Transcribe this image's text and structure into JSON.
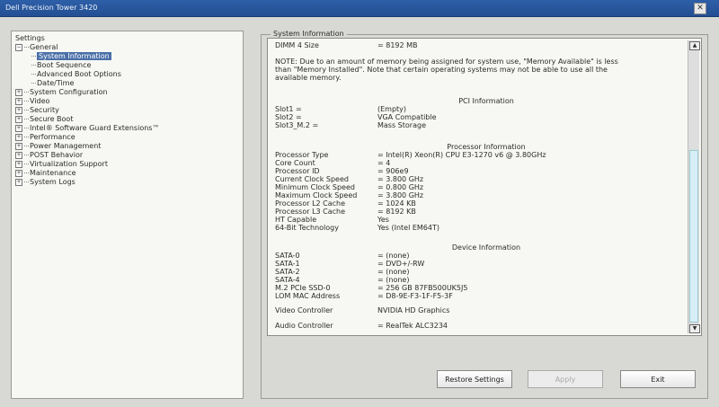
{
  "window": {
    "title": "Dell Precision Tower 3420",
    "close_glyph": "✕"
  },
  "settings_tree": {
    "root": "Settings",
    "general": {
      "label": "General",
      "expander": "−"
    },
    "general_children": [
      "System Information",
      "Boot Sequence",
      "Advanced Boot Options",
      "Date/Time"
    ],
    "sections": [
      "System Configuration",
      "Video",
      "Security",
      "Secure Boot",
      "Intel® Software Guard Extensions™",
      "Performance",
      "Power Management",
      "POST Behavior",
      "Virtualization Support",
      "Maintenance",
      "System Logs"
    ],
    "expander_plus": "+"
  },
  "system_info": {
    "group_title": "System Information",
    "dimm4": {
      "label": "DIMM 4 Size",
      "value": "= 8192 MB"
    },
    "note": "NOTE: Due to an amount of memory being assigned for system use, \"Memory Available\" is less than \"Memory Installed\". Note that certain operating systems may not be able to use all the available memory.",
    "pci_title": "PCI Information",
    "pci": [
      {
        "label": "Slot1 =",
        "value": "(Empty)"
      },
      {
        "label": "Slot2 =",
        "value": "VGA Compatible"
      },
      {
        "label": "Slot3_M.2 =",
        "value": "Mass Storage"
      }
    ],
    "processor_title": "Processor Information",
    "processor": [
      {
        "label": "Processor Type",
        "value": "= Intel(R) Xeon(R) CPU E3-1270 v6 @ 3.80GHz"
      },
      {
        "label": "Core Count",
        "value": "= 4"
      },
      {
        "label": "Processor ID",
        "value": "= 906e9"
      },
      {
        "label": "Current Clock Speed",
        "value": "= 3.800 GHz"
      },
      {
        "label": "Minimum Clock Speed",
        "value": "= 0.800 GHz"
      },
      {
        "label": "Maximum Clock Speed",
        "value": "= 3.800 GHz"
      },
      {
        "label": "Processor L2 Cache",
        "value": "= 1024 KB"
      },
      {
        "label": "Processor L3 Cache",
        "value": "= 8192 KB"
      },
      {
        "label": "HT Capable",
        "value": "Yes"
      },
      {
        "label": "64-Bit Technology",
        "value": "Yes (Intel EM64T)"
      }
    ],
    "device_title": "Device Information",
    "device": [
      {
        "label": "SATA-0",
        "value": "= (none)"
      },
      {
        "label": "SATA-1",
        "value": "= DVD+/-RW"
      },
      {
        "label": "SATA-2",
        "value": "= (none)"
      },
      {
        "label": "SATA-4",
        "value": "= (none)"
      },
      {
        "label": "M.2 PCIe SSD-0",
        "value": "= 256 GB 87FB500UK5J5"
      },
      {
        "label": "LOM MAC Address",
        "value": "= D8-9E-F3-1F-F5-3F"
      }
    ],
    "video": {
      "label": "Video Controller",
      "value": "NVIDIA HD Graphics"
    },
    "audio": {
      "label": "Audio Controller",
      "value": "= RealTek ALC3234"
    },
    "scroll_up": "▲",
    "scroll_down": "▼"
  },
  "buttons": {
    "restore": "Restore Settings",
    "apply": "Apply",
    "exit": "Exit"
  },
  "colors": {
    "title_bar": "#2d5fa8",
    "selection": "#4a6fa8",
    "background": "#d8d8d4"
  }
}
